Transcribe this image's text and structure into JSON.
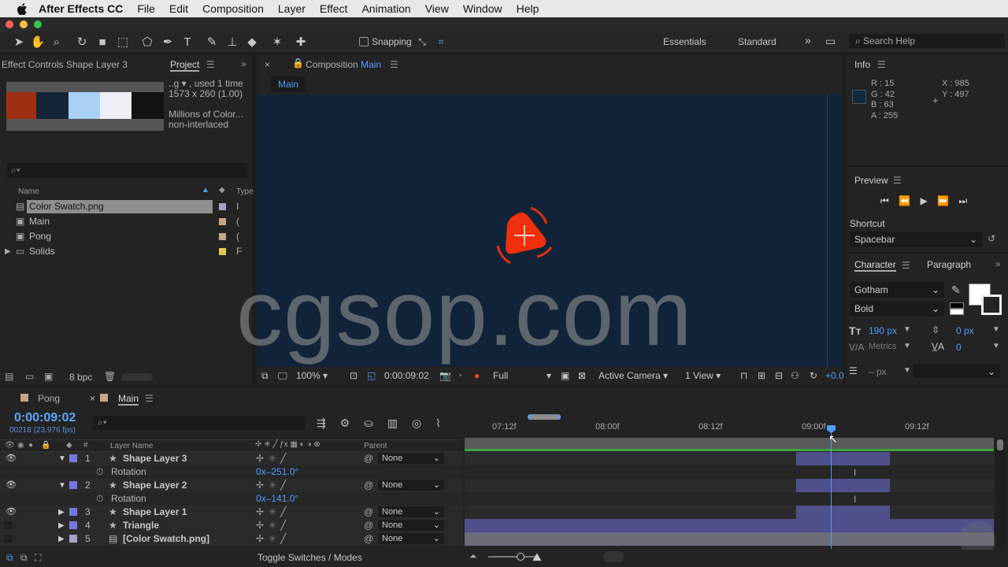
{
  "menubar": {
    "app": "After Effects CC",
    "items": [
      "File",
      "Edit",
      "Composition",
      "Layer",
      "Effect",
      "Animation",
      "View",
      "Window",
      "Help"
    ]
  },
  "toolbar": {
    "snapping": "Snapping",
    "workspaces": [
      "Essentials",
      "Standard"
    ],
    "search_placeholder": "Search Help"
  },
  "project_panel": {
    "effect_controls_tab": "Effect Controls Shape Layer 3",
    "project_tab": "Project",
    "info_lines": [
      "..g ▾ , used 1 time",
      "1573 x 260 (1.00)",
      "",
      "Millions of Color...",
      "non-interlaced"
    ],
    "columns": {
      "name": "Name",
      "type": "Type"
    },
    "items": [
      {
        "name": "Color Swatch.png",
        "icon": "image-file-icon",
        "label_color": "#a7a0c8",
        "type": "I",
        "selected": true
      },
      {
        "name": "Main",
        "icon": "composition-icon",
        "label_color": "#c4a584",
        "type": "(",
        "selected": false
      },
      {
        "name": "Pong",
        "icon": "composition-icon",
        "label_color": "#c4a584",
        "type": "(",
        "selected": false
      },
      {
        "name": "Solids",
        "icon": "folder-icon",
        "label_color": "#e2c94a",
        "type": "F",
        "selected": false
      }
    ],
    "swatch_colors": [
      "#9e2f12",
      "#132436",
      "#a8d1f3",
      "#eeeef4",
      "#121212"
    ],
    "bpc": "8 bpc"
  },
  "composition_panel": {
    "tab_prefix": "Composition",
    "tab_name": "Main",
    "subtab": "Main",
    "viewer_bg": "#112338",
    "footer": {
      "zoom": "100%",
      "timecode": "0:00:09:02",
      "resolution": "Full",
      "camera": "Active Camera",
      "views": "1 View",
      "exposure": "+0.0"
    }
  },
  "info_panel": {
    "title": "Info",
    "r": "R : 15",
    "g": "G : 42",
    "b": "B : 63",
    "a": "A : 255",
    "x": "X : 985",
    "y": "Y : 497",
    "swatch": "#0f2a3f"
  },
  "preview_panel": {
    "title": "Preview",
    "shortcut_label": "Shortcut",
    "shortcut_value": "Spacebar"
  },
  "character_panel": {
    "tab_character": "Character",
    "tab_paragraph": "Paragraph",
    "font": "Gotham",
    "style": "Bold",
    "size": "190 px",
    "leading": "0 px",
    "kerning": "Metrics",
    "tracking": "0",
    "stroke": "– px"
  },
  "timeline": {
    "tabs": [
      "Pong",
      "Main"
    ],
    "timecode": "0:00:09:02",
    "fps": "00218 (23.976 fps)",
    "col_layer_name": "Layer Name",
    "col_parent": "Parent",
    "ruler": [
      "07:12f",
      "08:00f",
      "08:12f",
      "09:00f",
      "09:12f"
    ],
    "layers": [
      {
        "num": "1",
        "name": "Shape Layer 3",
        "expanded": true,
        "color": "#7777e0",
        "eye": true,
        "parent": "None",
        "prop": "Rotation",
        "prop_value": "0x–251.0°"
      },
      {
        "num": "2",
        "name": "Shape Layer 2",
        "expanded": true,
        "color": "#7777e0",
        "eye": true,
        "parent": "None",
        "prop": "Rotation",
        "prop_value": "0x–141.0°"
      },
      {
        "num": "3",
        "name": "Shape Layer 1",
        "expanded": false,
        "color": "#7777e0",
        "eye": true,
        "parent": "None"
      },
      {
        "num": "4",
        "name": "Triangle",
        "expanded": false,
        "color": "#7777e0",
        "eye": false,
        "parent": "None"
      },
      {
        "num": "5",
        "name": "[Color Swatch.png]",
        "expanded": false,
        "color": "#a7a0c8",
        "eye": false,
        "parent": "None"
      }
    ],
    "toggle_label": "Toggle Switches / Modes"
  },
  "watermark": "cgsop.com"
}
